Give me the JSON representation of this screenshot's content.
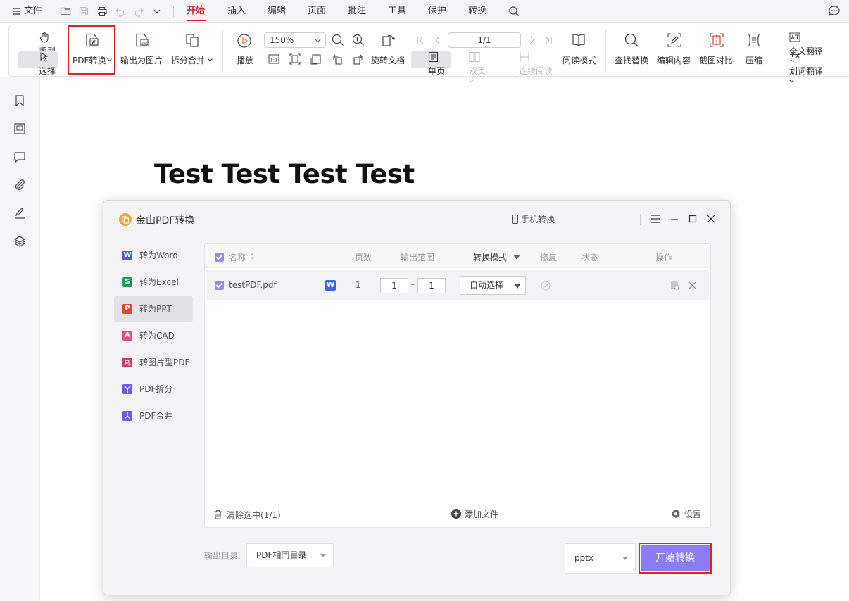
{
  "menubar": {
    "file_label": "文件",
    "tabs": [
      "开始",
      "插入",
      "编辑",
      "页面",
      "批注",
      "工具",
      "保护",
      "转换"
    ],
    "active_tab": "开始"
  },
  "ribbon": {
    "hand_tool": "手型",
    "select_tool": "选择",
    "pdf_convert": "PDF转换",
    "export_image": "输出为图片",
    "split_merge": "拆分合并",
    "play": "播放",
    "zoom_value": "150%",
    "page_value": "1/1",
    "rotate_doc": "旋转文档",
    "single_page": "单页",
    "double_page": "双页",
    "continuous_read": "连续阅读",
    "read_mode": "阅读模式",
    "find_replace": "查找替换",
    "edit_content": "编辑内容",
    "screenshot_compare": "截图对比",
    "compress": "压缩",
    "full_translate": "全文翻译",
    "word_translate": "划词翻译",
    "actual_size": "1:1"
  },
  "document": {
    "heading": "Test Test Test Test"
  },
  "dialog": {
    "title": "金山PDF转换",
    "mobile_convert": "手机转换",
    "sidebar": [
      {
        "label": "转为Word",
        "badge": "W",
        "color": "#3b66e0"
      },
      {
        "label": "转为Excel",
        "badge": "S",
        "color": "#1f9d55"
      },
      {
        "label": "转为PPT",
        "badge": "P",
        "color": "#e0452c"
      },
      {
        "label": "转为CAD",
        "badge": "A",
        "color": "#e04e8c"
      },
      {
        "label": "转图片型PDF",
        "badge": "P",
        "color": "#d9365c"
      },
      {
        "label": "PDF拆分",
        "badge": "Y",
        "color": "#6b5ce7"
      },
      {
        "label": "PDF合并",
        "badge": "M",
        "color": "#6b5ce7"
      }
    ],
    "active_item": "转为PPT",
    "table": {
      "headers": {
        "name": "名称",
        "pages": "页数",
        "range": "输出范围",
        "mode": "转换模式",
        "repair": "修复",
        "status": "状态",
        "action": "操作"
      },
      "rows": [
        {
          "name": "testPDF.pdf",
          "type_badge": "W",
          "pages": "1",
          "range_from": "1",
          "range_to": "1",
          "mode": "自动选择",
          "status": ""
        }
      ]
    },
    "footer": {
      "clear_selected": "清除选中(1/1)",
      "add_file": "添加文件",
      "settings": "设置"
    },
    "output_dir_label": "输出目录:",
    "output_dir_value": "PDF相同目录",
    "format_value": "pptx",
    "start_button": "开始转换"
  },
  "colors": {
    "accent_red": "#d81e2c",
    "highlight_red": "#e2231a",
    "start_button": "#8b7cf6",
    "checkbox": "#8f8ff0"
  }
}
